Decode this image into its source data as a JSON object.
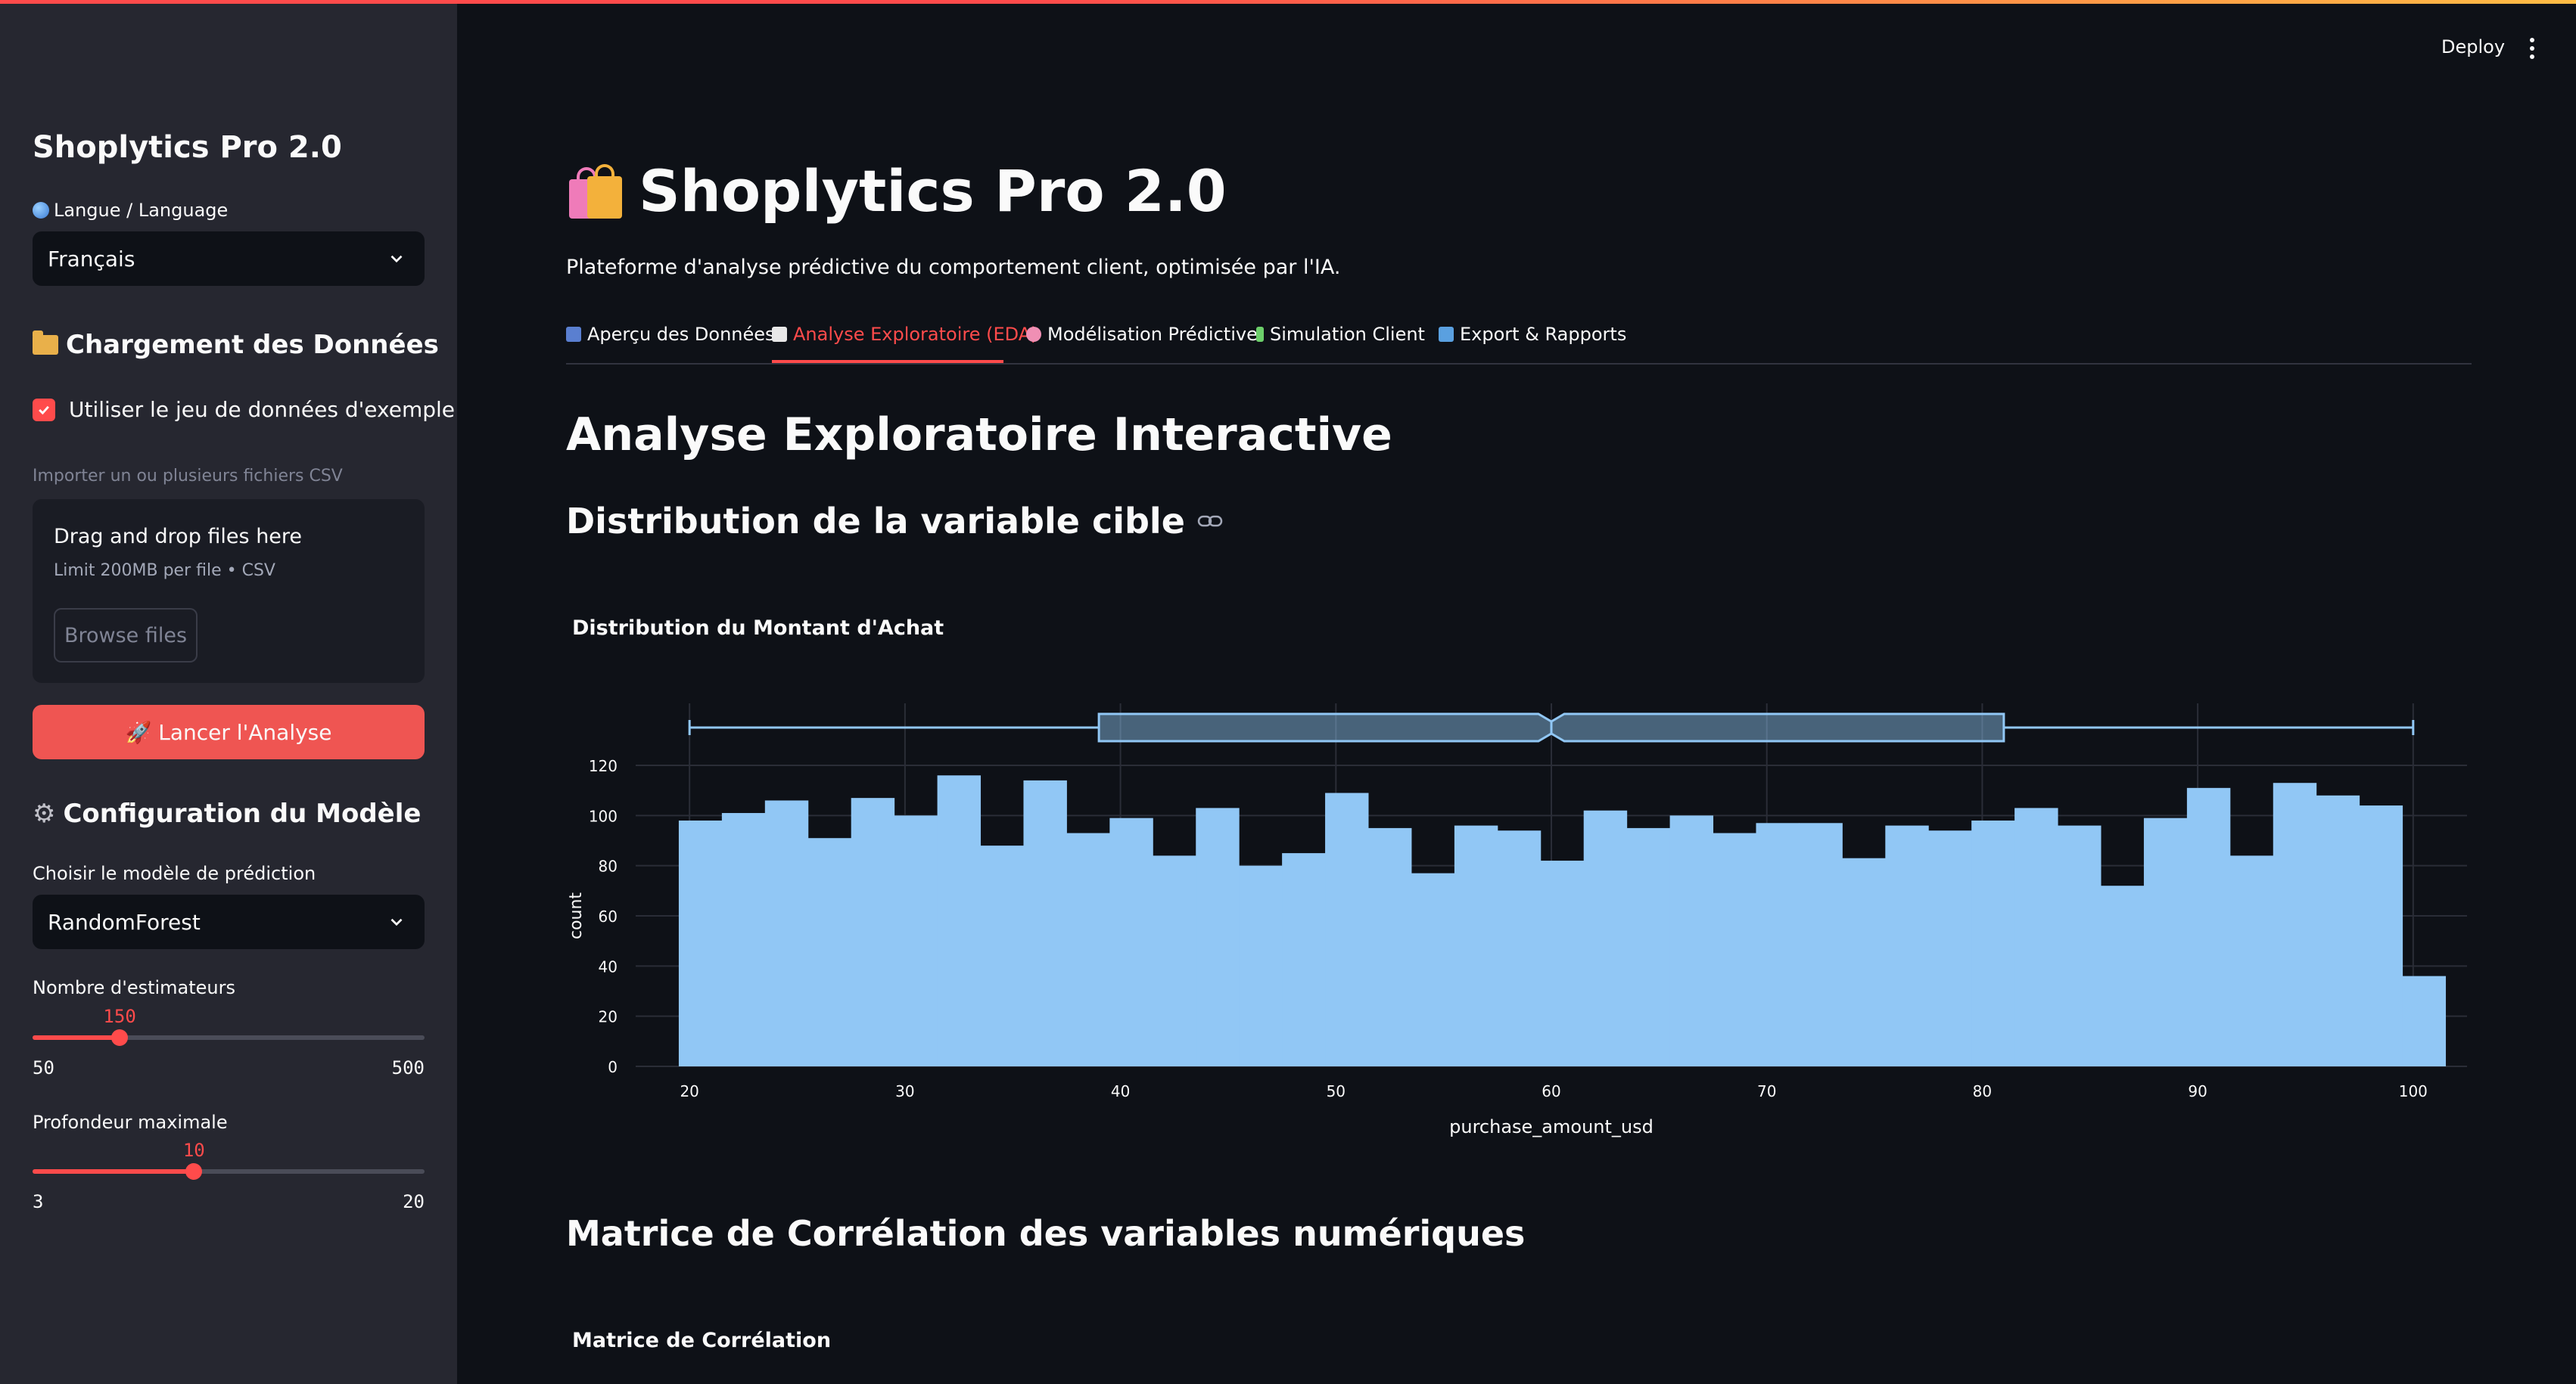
{
  "sidebar": {
    "title": "Shoplytics Pro 2.0",
    "language": {
      "label": "Langue / Language",
      "selected": "Français"
    },
    "data_section": {
      "heading": "Chargement des Données",
      "use_sample_checkbox": {
        "label": "Utiliser le jeu de données d'exemple",
        "checked": true
      },
      "upload_label": "Importer un ou plusieurs fichiers CSV",
      "dropzone": {
        "title": "Drag and drop files here",
        "limit": "Limit 200MB per file • CSV",
        "browse_label": "Browse files"
      }
    },
    "run_button": {
      "label": "🚀 Lancer l'Analyse"
    },
    "model_section": {
      "heading": "Configuration du Modèle",
      "model_select": {
        "label": "Choisir le modèle de prédiction",
        "selected": "RandomForest"
      },
      "estimators": {
        "label": "Nombre d'estimateurs",
        "value": 150,
        "value_text": "150",
        "min": "50",
        "max": "500"
      },
      "max_depth": {
        "label": "Profondeur maximale",
        "value": 10,
        "value_text": "10",
        "min": "3",
        "max": "20"
      }
    }
  },
  "header": {
    "deploy_label": "Deploy",
    "menu_icon": "kebab-menu-icon"
  },
  "main": {
    "title": "Shoplytics Pro 2.0",
    "title_icon": "shopping-bags-icon",
    "subtitle": "Plateforme d'analyse prédictive du comportement client, optimisée par l'IA.",
    "tabs": [
      {
        "label": "Aperçu des Données",
        "icon": "bar-chart-icon",
        "active": false
      },
      {
        "label": "Analyse Exploratoire (EDA)",
        "icon": "trend-chart-icon",
        "active": true
      },
      {
        "label": "Modélisation Prédictive",
        "icon": "brain-icon",
        "active": false
      },
      {
        "label": "Simulation Client",
        "icon": "test-tube-icon",
        "active": false
      },
      {
        "label": "Export & Rapports",
        "icon": "inbox-icon",
        "active": false
      }
    ],
    "section_title": "Analyse Exploratoire Interactive",
    "distribution_heading": "Distribution de la variable cible",
    "histogram_title": "Distribution du Montant d'Achat",
    "correlation_heading": "Matrice de Corrélation des variables numériques",
    "correlation_title": "Matrice de Corrélation"
  },
  "colors": {
    "accent": "#ff4b4b",
    "bar": "#91c7f5",
    "box": "#91c7f5",
    "background": "#0e1117",
    "sidebar": "#262730"
  },
  "chart_data": {
    "type": "bar",
    "title": "Distribution du Montant d'Achat",
    "xlabel": "purchase_amount_usd",
    "ylabel": "count",
    "xlim": [
      17.5,
      102.5
    ],
    "ylim": [
      0,
      120
    ],
    "x_ticks": [
      20,
      30,
      40,
      50,
      60,
      70,
      80,
      90,
      100
    ],
    "y_ticks": [
      0,
      20,
      40,
      60,
      80,
      100,
      120
    ],
    "bin_start": 19.5,
    "bin_width": 2,
    "values": [
      98,
      101,
      106,
      91,
      107,
      100,
      116,
      88,
      114,
      93,
      99,
      84,
      103,
      80,
      85,
      109,
      95,
      77,
      96,
      94,
      82,
      102,
      95,
      100,
      93,
      97,
      97,
      83,
      96,
      94,
      98,
      103,
      96,
      72,
      99,
      111,
      84,
      113,
      108,
      104,
      36
    ],
    "box": {
      "min": 20,
      "q1": 39,
      "median": 60,
      "q3": 81,
      "max": 100,
      "notch_low": 59.4,
      "notch_high": 60.6
    },
    "grid": true
  }
}
